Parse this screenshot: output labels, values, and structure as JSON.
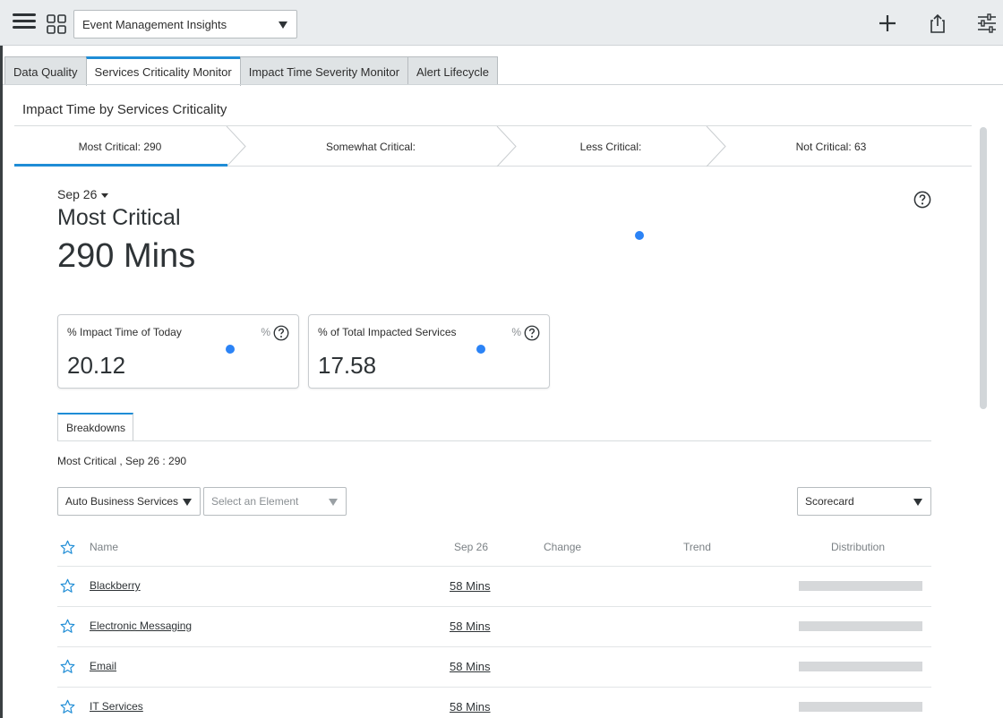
{
  "header": {
    "dashboard_selector": "Event Management Insights",
    "icons": [
      "menu-icon",
      "dashboards-grid-icon",
      "add-icon",
      "share-icon",
      "settings-sliders-icon"
    ]
  },
  "tabs": [
    {
      "label": "Data Quality",
      "active": false
    },
    {
      "label": "Services Criticality Monitor",
      "active": true
    },
    {
      "label": "Impact Time Severity Monitor",
      "active": false
    },
    {
      "label": "Alert Lifecycle",
      "active": false
    }
  ],
  "widget": {
    "title": "Impact Time by Services Criticality",
    "chevrons": [
      {
        "label": "Most Critical: 290",
        "active": true
      },
      {
        "label": "Somewhat Critical:",
        "active": false
      },
      {
        "label": "Less Critical:",
        "active": false
      },
      {
        "label": "Not Critical: 63",
        "active": false
      }
    ],
    "date": "Sep 26",
    "kpi_name": "Most Critical",
    "kpi_value": "290 Mins"
  },
  "cards": [
    {
      "title": "% Impact Time of Today",
      "unit": "%",
      "value": "20.12"
    },
    {
      "title": "% of Total Impacted Services",
      "unit": "%",
      "value": "17.58"
    }
  ],
  "breakdowns": {
    "tab_label": "Breakdowns",
    "caption": "Most Critical , Sep 26 : 290",
    "breakdown_select": "Auto Business Services",
    "element_select_placeholder": "Select an Element",
    "view_select": "Scorecard",
    "columns": {
      "name": "Name",
      "date": "Sep 26",
      "change": "Change",
      "trend": "Trend",
      "distribution": "Distribution"
    },
    "rows": [
      {
        "name": "Blackberry",
        "value": "58 Mins"
      },
      {
        "name": "Electronic Messaging",
        "value": "58 Mins"
      },
      {
        "name": "Email",
        "value": "58 Mins"
      },
      {
        "name": "IT Services",
        "value": "58 Mins"
      }
    ]
  },
  "colors": {
    "accent": "#1f8dd6",
    "dot": "#2b83f6",
    "header_bg": "#e9ecee"
  }
}
